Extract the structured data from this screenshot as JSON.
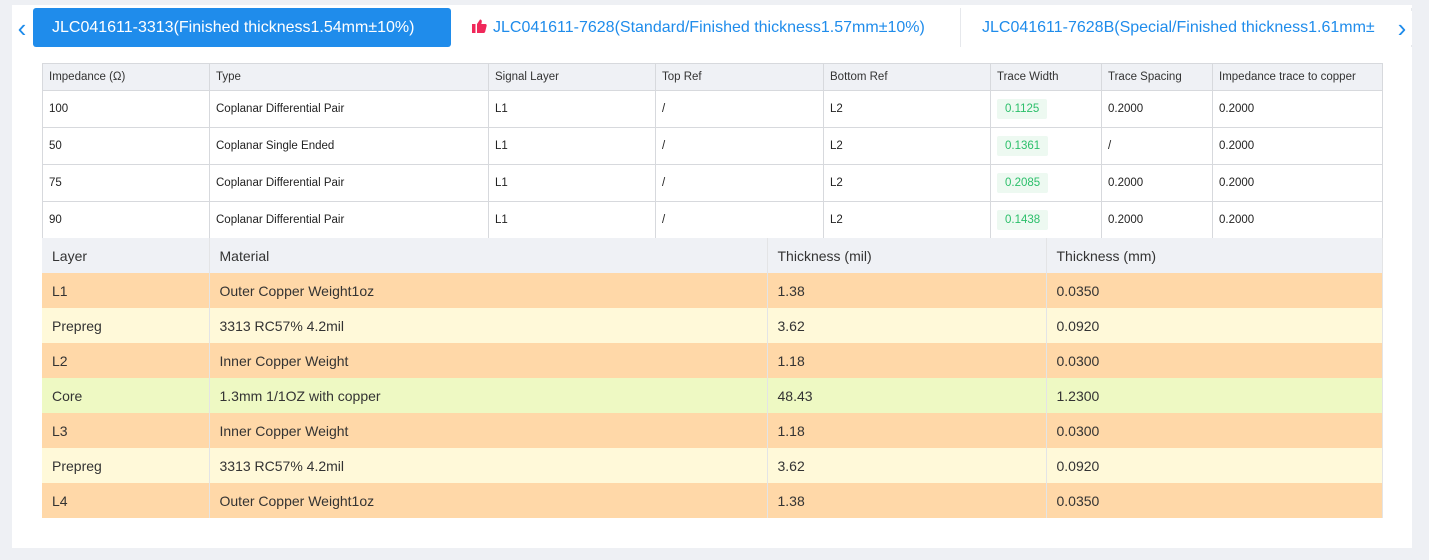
{
  "tabs": [
    {
      "label": "JLC041611-3313(Finished thickness1.54mm±10%)",
      "active": true,
      "icon": ""
    },
    {
      "label": "JLC041611-7628(Standard/Finished thickness1.57mm±10%)",
      "active": false,
      "icon": "thumbs-up-icon"
    },
    {
      "label": "JLC041611-7628B(Special/Finished thickness1.61mm±",
      "active": false,
      "icon": ""
    }
  ],
  "nav": {
    "prev": "‹",
    "next": "›"
  },
  "impedance": {
    "headers": [
      "Impedance (Ω)",
      "Type",
      "Signal Layer",
      "Top Ref",
      "Bottom Ref",
      "Trace Width",
      "Trace Spacing",
      "Impedance trace to copper"
    ],
    "rows": [
      [
        "100",
        "Coplanar Differential Pair",
        "L1",
        "/",
        "L2",
        "0.1125",
        "0.2000",
        "0.2000"
      ],
      [
        "50",
        "Coplanar Single Ended",
        "L1",
        "/",
        "L2",
        "0.1361",
        "/",
        "0.2000"
      ],
      [
        "75",
        "Coplanar Differential Pair",
        "L1",
        "/",
        "L2",
        "0.2085",
        "0.2000",
        "0.2000"
      ],
      [
        "90",
        "Coplanar Differential Pair",
        "L1",
        "/",
        "L2",
        "0.1438",
        "0.2000",
        "0.2000"
      ]
    ]
  },
  "stackup": {
    "headers": [
      "Layer",
      "Material",
      "Thickness (mil)",
      "Thickness (mm)"
    ],
    "rows": [
      [
        "L1",
        "Outer Copper Weight1oz",
        "1.38",
        "0.0350"
      ],
      [
        "Prepreg",
        "3313 RC57% 4.2mil",
        "3.62",
        "0.0920"
      ],
      [
        "L2",
        "Inner Copper Weight",
        "1.18",
        "0.0300"
      ],
      [
        "Core",
        "1.3mm 1/1OZ with copper",
        "48.43",
        "1.2300"
      ],
      [
        "L3",
        "Inner Copper Weight",
        "1.18",
        "0.0300"
      ],
      [
        "Prepreg",
        "3313 RC57% 4.2mil",
        "3.62",
        "0.0920"
      ],
      [
        "L4",
        "Outer Copper Weight1oz",
        "1.38",
        "0.0350"
      ]
    ]
  },
  "colors": {
    "accent": "#1f8ceb",
    "copper": "#ffd8a8",
    "prepreg": "#fff9d9",
    "core": "#eef9c3",
    "trace_width_text": "#2bbf6a",
    "hot_icon": "#f0285a"
  }
}
